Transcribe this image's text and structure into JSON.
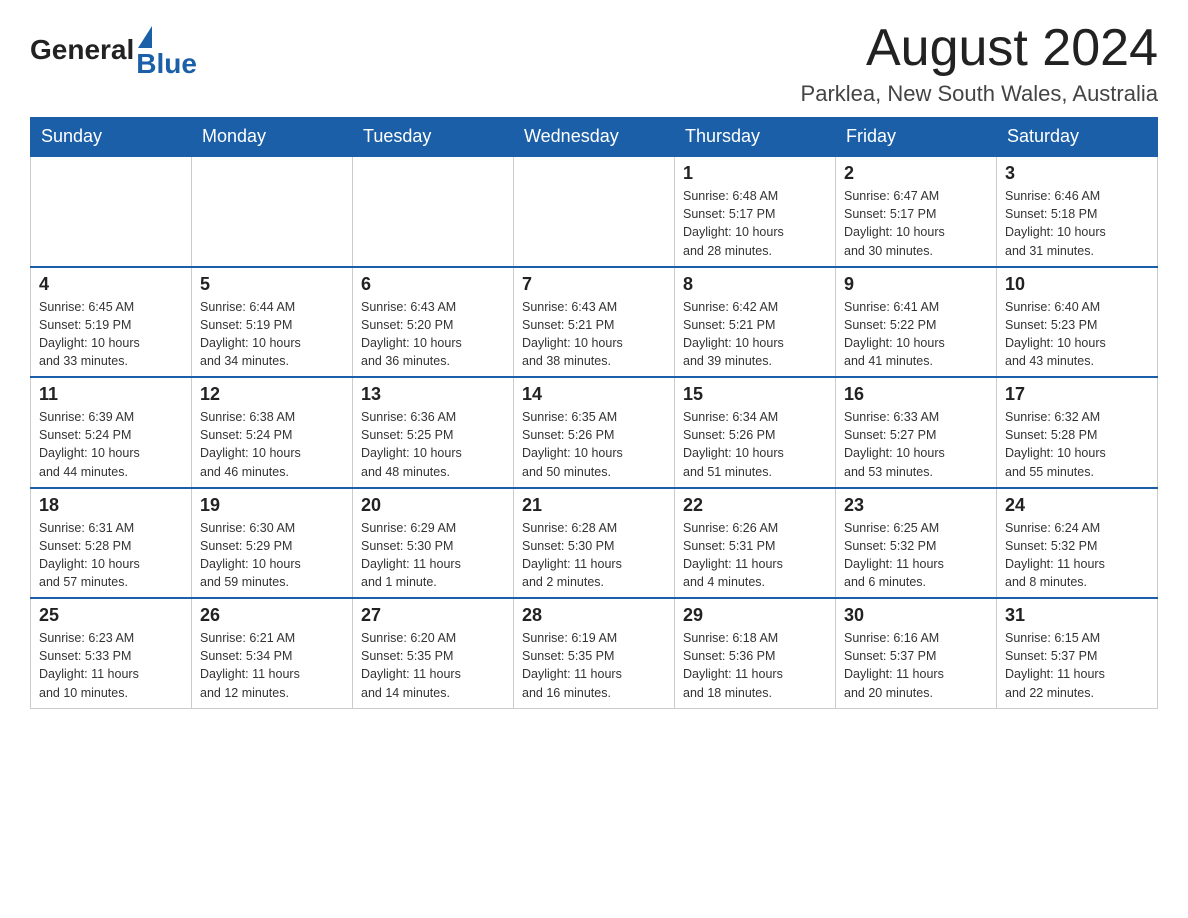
{
  "header": {
    "logo_general": "General",
    "logo_blue": "Blue",
    "month_title": "August 2024",
    "location": "Parklea, New South Wales, Australia"
  },
  "weekdays": [
    "Sunday",
    "Monday",
    "Tuesday",
    "Wednesday",
    "Thursday",
    "Friday",
    "Saturday"
  ],
  "weeks": [
    [
      {
        "day": "",
        "info": ""
      },
      {
        "day": "",
        "info": ""
      },
      {
        "day": "",
        "info": ""
      },
      {
        "day": "",
        "info": ""
      },
      {
        "day": "1",
        "info": "Sunrise: 6:48 AM\nSunset: 5:17 PM\nDaylight: 10 hours\nand 28 minutes."
      },
      {
        "day": "2",
        "info": "Sunrise: 6:47 AM\nSunset: 5:17 PM\nDaylight: 10 hours\nand 30 minutes."
      },
      {
        "day": "3",
        "info": "Sunrise: 6:46 AM\nSunset: 5:18 PM\nDaylight: 10 hours\nand 31 minutes."
      }
    ],
    [
      {
        "day": "4",
        "info": "Sunrise: 6:45 AM\nSunset: 5:19 PM\nDaylight: 10 hours\nand 33 minutes."
      },
      {
        "day": "5",
        "info": "Sunrise: 6:44 AM\nSunset: 5:19 PM\nDaylight: 10 hours\nand 34 minutes."
      },
      {
        "day": "6",
        "info": "Sunrise: 6:43 AM\nSunset: 5:20 PM\nDaylight: 10 hours\nand 36 minutes."
      },
      {
        "day": "7",
        "info": "Sunrise: 6:43 AM\nSunset: 5:21 PM\nDaylight: 10 hours\nand 38 minutes."
      },
      {
        "day": "8",
        "info": "Sunrise: 6:42 AM\nSunset: 5:21 PM\nDaylight: 10 hours\nand 39 minutes."
      },
      {
        "day": "9",
        "info": "Sunrise: 6:41 AM\nSunset: 5:22 PM\nDaylight: 10 hours\nand 41 minutes."
      },
      {
        "day": "10",
        "info": "Sunrise: 6:40 AM\nSunset: 5:23 PM\nDaylight: 10 hours\nand 43 minutes."
      }
    ],
    [
      {
        "day": "11",
        "info": "Sunrise: 6:39 AM\nSunset: 5:24 PM\nDaylight: 10 hours\nand 44 minutes."
      },
      {
        "day": "12",
        "info": "Sunrise: 6:38 AM\nSunset: 5:24 PM\nDaylight: 10 hours\nand 46 minutes."
      },
      {
        "day": "13",
        "info": "Sunrise: 6:36 AM\nSunset: 5:25 PM\nDaylight: 10 hours\nand 48 minutes."
      },
      {
        "day": "14",
        "info": "Sunrise: 6:35 AM\nSunset: 5:26 PM\nDaylight: 10 hours\nand 50 minutes."
      },
      {
        "day": "15",
        "info": "Sunrise: 6:34 AM\nSunset: 5:26 PM\nDaylight: 10 hours\nand 51 minutes."
      },
      {
        "day": "16",
        "info": "Sunrise: 6:33 AM\nSunset: 5:27 PM\nDaylight: 10 hours\nand 53 minutes."
      },
      {
        "day": "17",
        "info": "Sunrise: 6:32 AM\nSunset: 5:28 PM\nDaylight: 10 hours\nand 55 minutes."
      }
    ],
    [
      {
        "day": "18",
        "info": "Sunrise: 6:31 AM\nSunset: 5:28 PM\nDaylight: 10 hours\nand 57 minutes."
      },
      {
        "day": "19",
        "info": "Sunrise: 6:30 AM\nSunset: 5:29 PM\nDaylight: 10 hours\nand 59 minutes."
      },
      {
        "day": "20",
        "info": "Sunrise: 6:29 AM\nSunset: 5:30 PM\nDaylight: 11 hours\nand 1 minute."
      },
      {
        "day": "21",
        "info": "Sunrise: 6:28 AM\nSunset: 5:30 PM\nDaylight: 11 hours\nand 2 minutes."
      },
      {
        "day": "22",
        "info": "Sunrise: 6:26 AM\nSunset: 5:31 PM\nDaylight: 11 hours\nand 4 minutes."
      },
      {
        "day": "23",
        "info": "Sunrise: 6:25 AM\nSunset: 5:32 PM\nDaylight: 11 hours\nand 6 minutes."
      },
      {
        "day": "24",
        "info": "Sunrise: 6:24 AM\nSunset: 5:32 PM\nDaylight: 11 hours\nand 8 minutes."
      }
    ],
    [
      {
        "day": "25",
        "info": "Sunrise: 6:23 AM\nSunset: 5:33 PM\nDaylight: 11 hours\nand 10 minutes."
      },
      {
        "day": "26",
        "info": "Sunrise: 6:21 AM\nSunset: 5:34 PM\nDaylight: 11 hours\nand 12 minutes."
      },
      {
        "day": "27",
        "info": "Sunrise: 6:20 AM\nSunset: 5:35 PM\nDaylight: 11 hours\nand 14 minutes."
      },
      {
        "day": "28",
        "info": "Sunrise: 6:19 AM\nSunset: 5:35 PM\nDaylight: 11 hours\nand 16 minutes."
      },
      {
        "day": "29",
        "info": "Sunrise: 6:18 AM\nSunset: 5:36 PM\nDaylight: 11 hours\nand 18 minutes."
      },
      {
        "day": "30",
        "info": "Sunrise: 6:16 AM\nSunset: 5:37 PM\nDaylight: 11 hours\nand 20 minutes."
      },
      {
        "day": "31",
        "info": "Sunrise: 6:15 AM\nSunset: 5:37 PM\nDaylight: 11 hours\nand 22 minutes."
      }
    ]
  ]
}
